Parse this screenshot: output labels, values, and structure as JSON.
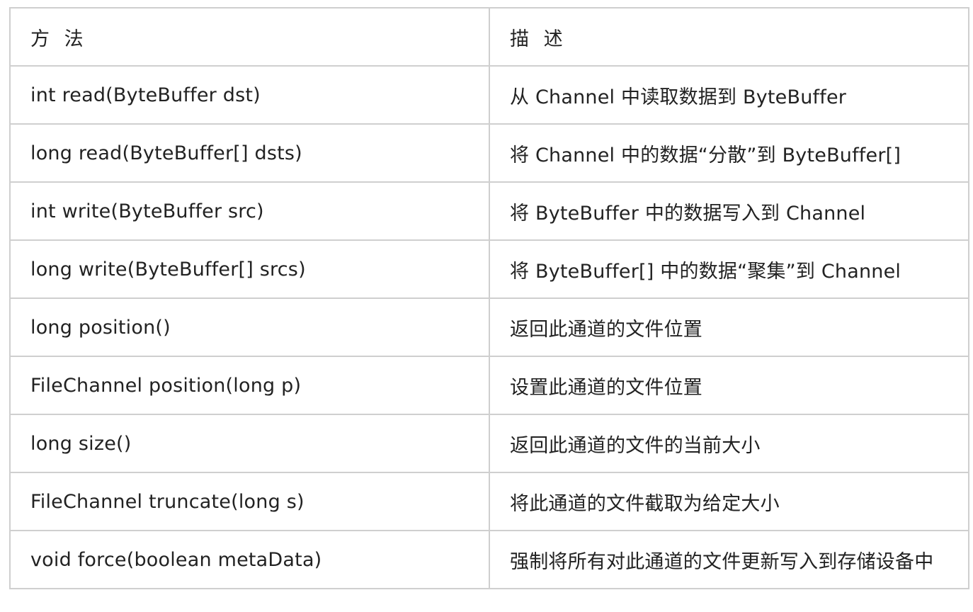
{
  "table": {
    "headers": [
      "方 法",
      "描 述"
    ],
    "rows": [
      [
        "int read(ByteBuffer dst)",
        "从 Channel 中读取数据到 ByteBuffer"
      ],
      [
        "long read(ByteBuffer[] dsts)",
        "将 Channel 中的数据“分散”到 ByteBuffer[]"
      ],
      [
        "int write(ByteBuffer src)",
        "将 ByteBuffer 中的数据写入到 Channel"
      ],
      [
        "long write(ByteBuffer[] srcs)",
        "将 ByteBuffer[] 中的数据“聚集”到 Channel"
      ],
      [
        "long position()",
        "返回此通道的文件位置"
      ],
      [
        "FileChannel position(long p)",
        "设置此通道的文件位置"
      ],
      [
        "long size()",
        "返回此通道的文件的当前大小"
      ],
      [
        "FileChannel truncate(long s)",
        "将此通道的文件截取为给定大小"
      ],
      [
        "void force(boolean metaData)",
        "强制将所有对此通道的文件更新写入到存储设备中"
      ]
    ]
  },
  "colors": {
    "border": "#cfcfcf",
    "text": "#222222",
    "background": "#ffffff"
  }
}
